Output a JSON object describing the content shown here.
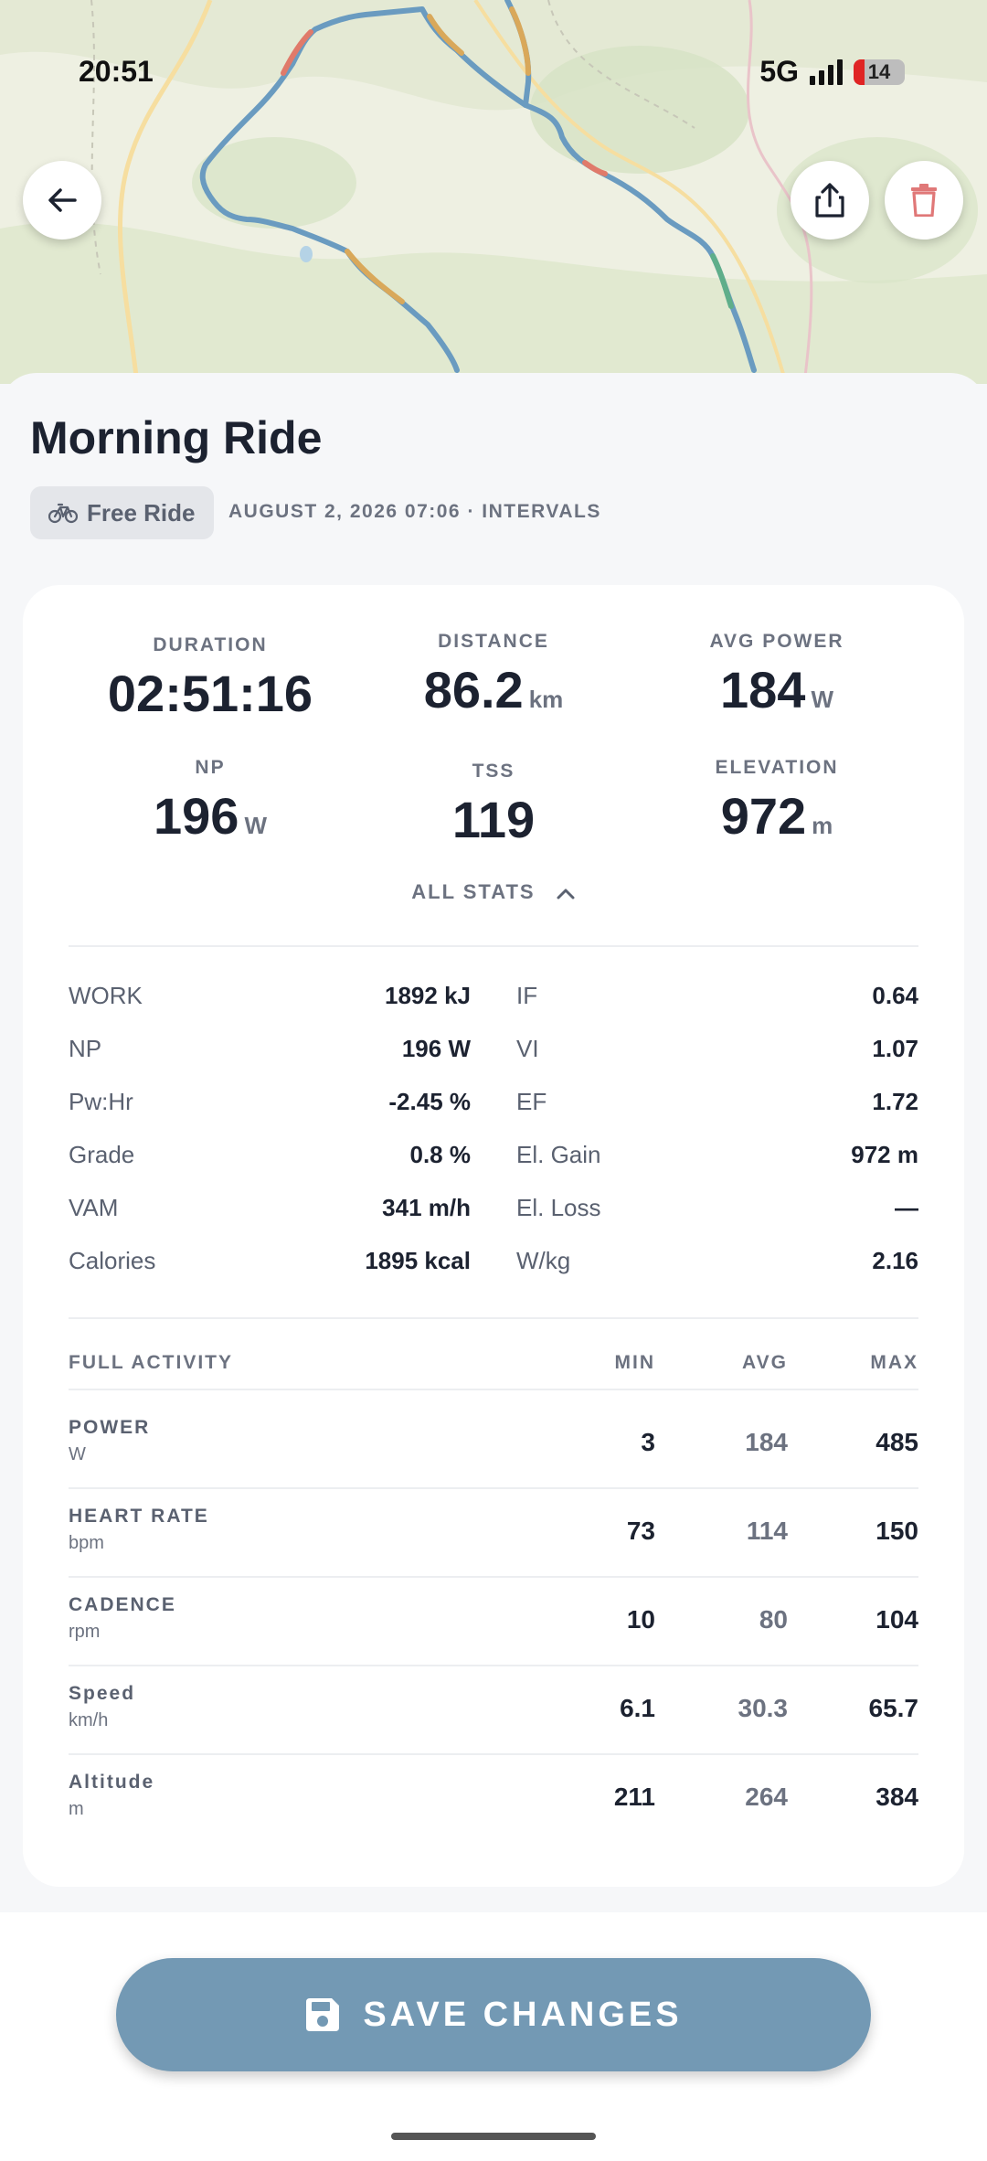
{
  "status_bar": {
    "time": "20:51",
    "network": "5G",
    "battery": "14"
  },
  "activity": {
    "title": "Morning Ride",
    "type_label": "Free Ride",
    "meta": "AUGUST 2, 2026 07:06 · INTERVALS"
  },
  "summary": [
    {
      "label": "DURATION",
      "value": "02:51:16",
      "unit": ""
    },
    {
      "label": "DISTANCE",
      "value": "86.2",
      "unit": "km"
    },
    {
      "label": "AVG POWER",
      "value": "184",
      "unit": "W"
    },
    {
      "label": "NP",
      "value": "196",
      "unit": "W"
    },
    {
      "label": "TSS",
      "value": "119",
      "unit": ""
    },
    {
      "label": "ELEVATION",
      "value": "972",
      "unit": "m"
    }
  ],
  "all_stats_label": "ALL STATS",
  "stats_left": [
    {
      "k": "WORK",
      "v": "1892 kJ"
    },
    {
      "k": "NP",
      "v": "196 W"
    },
    {
      "k": "Pw:Hr",
      "v": "-2.45 %"
    },
    {
      "k": "Grade",
      "v": "0.8 %"
    },
    {
      "k": "VAM",
      "v": "341 m/h"
    },
    {
      "k": "Calories",
      "v": "1895 kcal"
    }
  ],
  "stats_right": [
    {
      "k": "IF",
      "v": "0.64"
    },
    {
      "k": "VI",
      "v": "1.07"
    },
    {
      "k": "EF",
      "v": "1.72"
    },
    {
      "k": "El. Gain",
      "v": "972 m"
    },
    {
      "k": "El. Loss",
      "v": "—"
    },
    {
      "k": "W/kg",
      "v": "2.16"
    }
  ],
  "table": {
    "header": [
      "FULL ACTIVITY",
      "MIN",
      "AVG",
      "MAX"
    ],
    "rows": [
      {
        "name": "POWER",
        "unit": "W",
        "min": "3",
        "avg": "184",
        "max": "485"
      },
      {
        "name": "HEART RATE",
        "unit": "bpm",
        "min": "73",
        "avg": "114",
        "max": "150"
      },
      {
        "name": "CADENCE",
        "unit": "rpm",
        "min": "10",
        "avg": "80",
        "max": "104"
      },
      {
        "name": "Speed",
        "unit": "km/h",
        "min": "6.1",
        "avg": "30.3",
        "max": "65.7"
      },
      {
        "name": "Altitude",
        "unit": "m",
        "min": "211",
        "avg": "264",
        "max": "384"
      }
    ]
  },
  "save_label": "SAVE CHANGES",
  "icons": {
    "back": "arrow-left-icon",
    "share": "share-icon",
    "delete": "trash-icon",
    "bike": "bicycle-icon",
    "save": "floppy-disk-icon",
    "collapse": "chevron-up-icon"
  },
  "colors": {
    "accent": "#7399b4",
    "delete": "#e07878",
    "route": "#6a9bc0"
  }
}
